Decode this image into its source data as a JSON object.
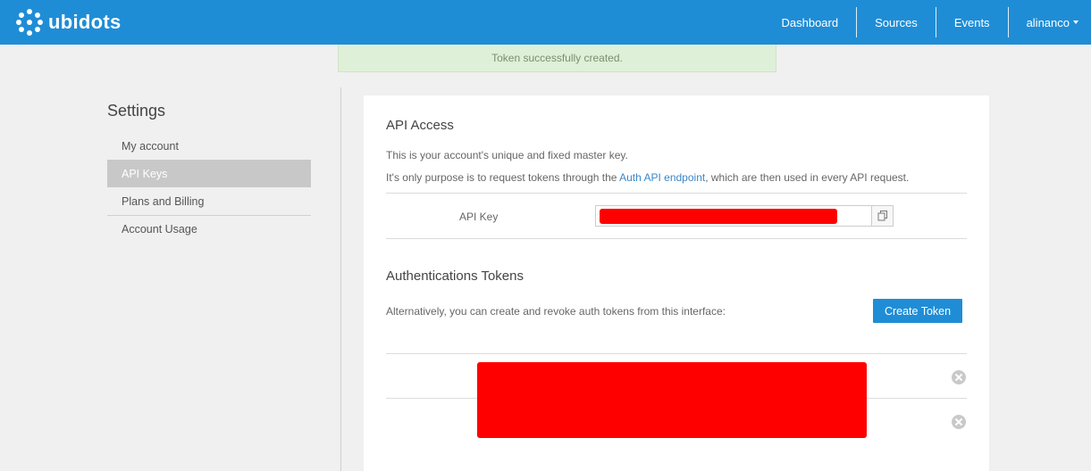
{
  "brand": {
    "name": "ubidots"
  },
  "nav": {
    "items": [
      {
        "label": "Dashboard"
      },
      {
        "label": "Sources"
      },
      {
        "label": "Events"
      }
    ],
    "user": {
      "label": "alinanco"
    }
  },
  "flash": {
    "message": "Token successfully created."
  },
  "sidebar": {
    "title": "Settings",
    "items": [
      {
        "label": "My account"
      },
      {
        "label": "API Keys",
        "active": true
      },
      {
        "label": "Plans and Billing"
      },
      {
        "label": "Account Usage"
      }
    ]
  },
  "api_access": {
    "heading": "API Access",
    "desc1": "This is your account's unique and fixed master key.",
    "desc2_pre": "It's only purpose is to request tokens through the ",
    "desc2_link": "Auth API endpoint",
    "desc2_post": ", which are then used in every API request.",
    "key_label": "API Key"
  },
  "auth_tokens": {
    "heading": "Authentications Tokens",
    "desc": "Alternatively, you can create and revoke auth tokens from this interface:",
    "create_label": "Create Token"
  },
  "colors": {
    "brand_blue": "#1f8dd6",
    "flash_bg": "#dff0d8",
    "redaction": "#ff0000",
    "link": "#3a86c8"
  }
}
